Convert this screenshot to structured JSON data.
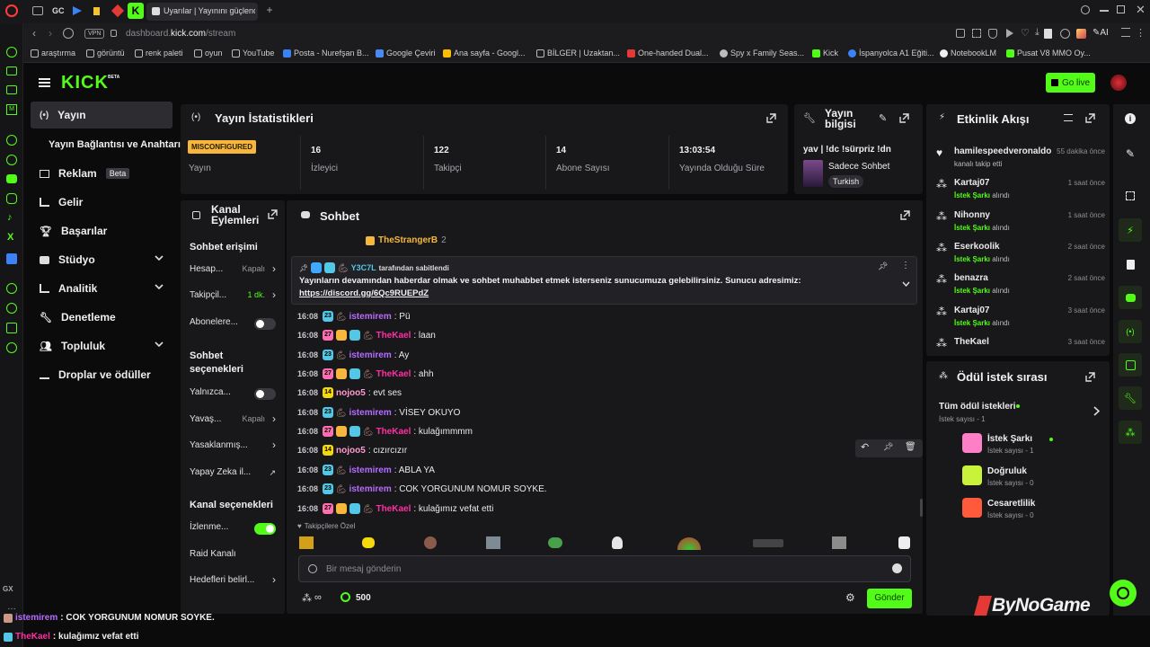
{
  "browser": {
    "tab_gc": "GC",
    "active_tab_title": "Uyarılar | Yayınını güçlendir",
    "url_prefix": "dashboard.",
    "url_domain": "kick.com",
    "url_path": "/stream",
    "vpn": "VPN",
    "ai": "AI",
    "bookmarks": [
      "araştırma",
      "görüntü",
      "renk paleti",
      "oyun",
      "YouTube",
      "Posta - Nurefşan B...",
      "Google Çeviri",
      "Ana sayfa - Googl...",
      "BİLGER | Uzaktan...",
      "One-handed Dual...",
      "Spy x Family Seas...",
      "Kick",
      "İspanyolca A1 Eğiti...",
      "NotebookLM",
      "Pusat V8 MMO Oy..."
    ],
    "rail_gx": "GX"
  },
  "header": {
    "logo": "KICK",
    "logo_beta": "BETA",
    "go_live": "Go live"
  },
  "sidebar": {
    "items": [
      {
        "label": "Yayın"
      },
      {
        "label": "Yayın Bağlantısı ve Anahtarı"
      },
      {
        "label": "Reklam",
        "badge": "Beta"
      },
      {
        "label": "Gelir"
      },
      {
        "label": "Başarılar"
      },
      {
        "label": "Stüdyo"
      },
      {
        "label": "Analitik"
      },
      {
        "label": "Denetleme"
      },
      {
        "label": "Topluluk"
      },
      {
        "label": "Droplar ve ödüller"
      }
    ]
  },
  "stats": {
    "title": "Yayın İstatistikleri",
    "status_badge": "MISCONFIGURED",
    "status_label": "Yayın",
    "items": [
      {
        "value": "16",
        "label": "İzleyici"
      },
      {
        "value": "122",
        "label": "Takipçi"
      },
      {
        "value": "14",
        "label": "Abone Sayısı"
      },
      {
        "value": "13:03:54",
        "label": "Yayında Olduğu Süre"
      }
    ]
  },
  "stream_info": {
    "title_line1": "Yayın",
    "title_line2": "bilgisi",
    "stream_title": "yav | !dc !sürpriz !dn",
    "category": "Sadece Sohbet",
    "language": "Turkish"
  },
  "channel_actions": {
    "title_line1": "Kanal",
    "title_line2": "Eylemleri",
    "chat_access_heading": "Sohbet erişimi",
    "rows_access": [
      {
        "label": "Hesap...",
        "value": "Kapalı"
      },
      {
        "label": "Takipçil...",
        "value": "1 dk."
      },
      {
        "label": "Abonelere...",
        "value": ""
      }
    ],
    "chat_options_heading_1": "Sohbet",
    "chat_options_heading_2": "seçenekleri",
    "rows_options": [
      {
        "label": "Yalnızca...",
        "value": ""
      },
      {
        "label": "Yavaş...",
        "value": "Kapalı"
      },
      {
        "label": "Yasaklanmış...",
        "value": ""
      },
      {
        "label": "Yapay Zeka il...",
        "value": ""
      }
    ],
    "channel_options_heading": "Kanal seçenekleri",
    "rows_channel": [
      {
        "label": "İzlenme...",
        "value": ""
      },
      {
        "label": "Raid Kanalı",
        "value": ""
      },
      {
        "label": "Hedefleri belirl...",
        "value": ""
      }
    ]
  },
  "chat": {
    "title": "Sohbet",
    "top_user": "TheStrangerB",
    "top_user_count": "2",
    "pinned_by_user": "Y3C7L",
    "pinned_by_suffix": "tarafından sabitlendi",
    "pinned_text": "Yayınların devamından haberdar olmak ve sohbet muhabbet etmek isterseniz sunucumuza gelebilirsiniz. Sunucu adresimiz:",
    "pinned_link": "https://discord.gg/6Qc9RUEPdZ",
    "messages": [
      {
        "time": "16:08",
        "user": "istemirem",
        "text": ": Pü",
        "color": "#b66cff",
        "months": "23"
      },
      {
        "time": "16:08",
        "user": "TheKael",
        "text": ": laan",
        "color": "#ff2fa0",
        "months": "27"
      },
      {
        "time": "16:08",
        "user": "istemirem",
        "text": ": Ay",
        "color": "#b66cff",
        "months": "23"
      },
      {
        "time": "16:08",
        "user": "TheKael",
        "text": ": ahh",
        "color": "#ff2fa0",
        "months": "27"
      },
      {
        "time": "16:08",
        "user": "nojoo5",
        "text": ": evt ses",
        "color": "#ff9bd0",
        "months": "14"
      },
      {
        "time": "16:08",
        "user": "istemirem",
        "text": ": VİSEY OKUYO",
        "color": "#b66cff",
        "months": "23"
      },
      {
        "time": "16:08",
        "user": "TheKael",
        "text": ": kulağımmmm",
        "color": "#ff2fa0",
        "months": "27"
      },
      {
        "time": "16:08",
        "user": "nojoo5",
        "text": ": cızırcızır",
        "color": "#ff9bd0",
        "months": "14"
      },
      {
        "time": "16:08",
        "user": "istemirem",
        "text": ": ABLA YA",
        "color": "#b66cff",
        "months": "23"
      },
      {
        "time": "16:08",
        "user": "istemirem",
        "text": ": COK YORGUNUM NOMUR SOYKE.",
        "color": "#b66cff",
        "months": "23"
      },
      {
        "time": "16:08",
        "user": "TheKael",
        "text": ": kulağımız vefat etti",
        "color": "#ff2fa0",
        "months": "27"
      }
    ],
    "followers_only_label": "Takipçilere Özel",
    "input_placeholder": "Bir mesaj gönderin",
    "points_value": "500",
    "send_label": "Gönder"
  },
  "activity": {
    "title": "Etkinlik Akışı",
    "events": [
      {
        "user": "hamilespeedveronaldo",
        "time": "55 dakika önce",
        "sub": "kanalı takip etti",
        "sub_green": ""
      },
      {
        "user": "Kartaj07",
        "time": "1 saat önce",
        "sub_green": "İstek Şarkı",
        "sub": "alındı"
      },
      {
        "user": "Nihonny",
        "time": "1 saat önce",
        "sub_green": "İstek Şarkı",
        "sub": "alındı"
      },
      {
        "user": "Eserkoolik",
        "time": "2 saat önce",
        "sub_green": "İstek Şarkı",
        "sub": "alındı"
      },
      {
        "user": "benazra",
        "time": "2 saat önce",
        "sub_green": "İstek Şarkı",
        "sub": "alındı"
      },
      {
        "user": "Kartaj07",
        "time": "3 saat önce",
        "sub_green": "İstek Şarkı",
        "sub": "alındı"
      },
      {
        "user": "TheKael",
        "time": "3 saat önce",
        "sub_green": "",
        "sub": ""
      }
    ]
  },
  "rewards": {
    "title": "Ödül istek sırası",
    "all_label": "Tüm ödül istekleri",
    "all_count": "İstek sayısı - 1",
    "items": [
      {
        "name": "İstek Şarkı",
        "count": "İstek sayısı - 1",
        "color": "#ff7fc7"
      },
      {
        "name": "Doğruluk",
        "count": "İstek sayısı - 0",
        "color": "#c9f23a"
      },
      {
        "name": "Cesaretlilik",
        "count": "İstek sayısı - 0",
        "color": "#ff5a3c"
      }
    ]
  },
  "overlay": {
    "brand": "ByNoGame",
    "lines": [
      {
        "user": "istemirem",
        "text": ": COK YORGUNUM NOMUR SOYKE.",
        "color": "#b66cff"
      },
      {
        "user": "TheKael",
        "text": ": kulağımız vefat etti",
        "color": "#ff2fa0"
      }
    ]
  },
  "colors": {
    "accent": "#53fc18",
    "bg": "#0b0b0c",
    "panel": "#18181b"
  }
}
